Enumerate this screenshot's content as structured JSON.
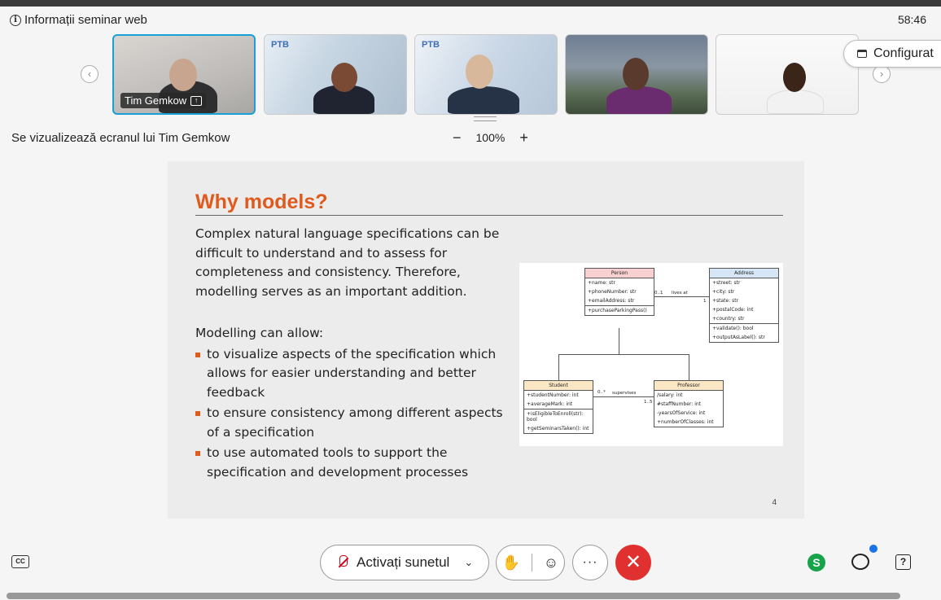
{
  "header": {
    "info_title": "Informații seminar web",
    "timer": "58:46",
    "config_label": "Configurat"
  },
  "participants": [
    {
      "name": "Tim Gemkow",
      "active": true,
      "logo": ""
    },
    {
      "name": "",
      "active": false,
      "logo": "PTB"
    },
    {
      "name": "",
      "active": false,
      "logo": "PTB"
    },
    {
      "name": "",
      "active": false,
      "logo": ""
    },
    {
      "name": "",
      "active": false,
      "logo": ""
    }
  ],
  "share": {
    "status": "Se vizualizează ecranul lui Tim Gemkow",
    "zoom": "100%",
    "zoom_out": "−",
    "zoom_in": "+"
  },
  "slide": {
    "title": "Why models?",
    "paragraph": "Complex natural language specifications can be difficult to understand and to assess for completeness and consistency. Therefore, modelling serves as an important addition.",
    "lead": "Modelling can allow:",
    "bullets": [
      "to visualize aspects of the specification which allows for easier understanding and better feedback",
      "to ensure consistency among different aspects of a specification",
      "to use automated tools to support the specification and development processes"
    ],
    "page_number": "4",
    "uml": {
      "person": {
        "name": "Person",
        "attrs": [
          "+name: str",
          "+phoneNumber: str",
          "+emailAddress: str"
        ],
        "ops": [
          "+purchaseParkingPass()"
        ]
      },
      "address": {
        "name": "Address",
        "attrs": [
          "+street: str",
          "+city: str",
          "+state: str",
          "+postalCode: int",
          "+country: str"
        ],
        "ops": [
          "+validate(): bool",
          "+outputAsLabel(): str"
        ]
      },
      "student": {
        "name": "Student",
        "attrs": [
          "+studentNumber: int",
          "+averageMark: int"
        ],
        "ops": [
          "+isEligibleToEnroll(str): bool",
          "+getSeminarsTaken(): int"
        ]
      },
      "professor": {
        "name": "Professor",
        "attrs": [
          "/salary: int",
          "#staffNumber: int",
          "-yearsOfService: int",
          "+numberOfClasses: int"
        ],
        "ops": []
      },
      "assoc_lives": {
        "label": "lives at",
        "mult_left": "0..1",
        "mult_right": "1"
      },
      "assoc_supervises": {
        "label": "supervises",
        "mult_left": "0..*",
        "mult_right": "1..5"
      }
    }
  },
  "controls": {
    "cc": "CC",
    "mute_label": "Activați sunetul",
    "more": "···",
    "leave": "✕",
    "spark_letter": "S",
    "help": "?"
  },
  "colors": {
    "accent": "#e05a1e",
    "active_border": "#1aa0d6",
    "leave": "#e0302f",
    "notify": "#1a73e8"
  }
}
